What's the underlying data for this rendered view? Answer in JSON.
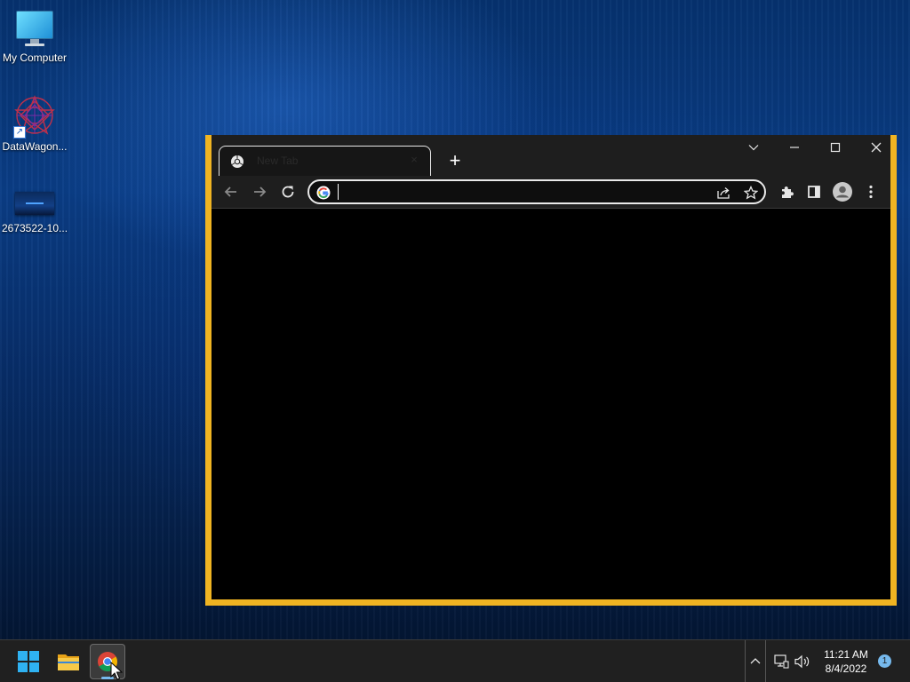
{
  "desktop": {
    "icons": [
      {
        "label": "My Computer",
        "icon": "monitor-icon"
      },
      {
        "label": "DataWagon...",
        "icon": "datawagon-icon"
      },
      {
        "label": "2673522-10...",
        "icon": "image-file-icon"
      }
    ]
  },
  "browser": {
    "tab": {
      "title": "New Tab",
      "favicon": "chrome-icon",
      "close": "×"
    },
    "new_tab_label": "+",
    "window_controls": [
      "tab-search-icon",
      "minimize-icon",
      "maximize-icon",
      "close-icon"
    ],
    "address_bar": {
      "value": "",
      "placeholder": ""
    },
    "colors": {
      "frame_highlight": "#f0b422",
      "toolbar": "#1e1e1e",
      "content": "#000000"
    }
  },
  "taskbar": {
    "items": [
      "start-icon",
      "file-explorer-icon",
      "chrome-icon"
    ],
    "active": "chrome-icon",
    "clock": {
      "time": "11:21 AM",
      "date": "8/4/2022"
    },
    "notification_count": "1"
  }
}
